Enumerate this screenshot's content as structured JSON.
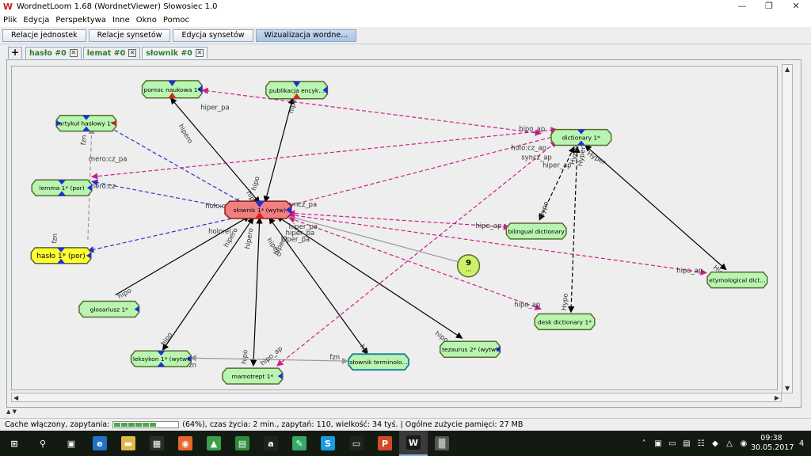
{
  "window": {
    "title": "WordnetLoom 1.68 (WordnetViewer) Słowosiec 1.0",
    "icon": "wordnetloom-app-icon",
    "minimize_label": "—",
    "maximize_label": "❐",
    "close_label": "✕"
  },
  "menu": [
    "Plik",
    "Edycja",
    "Perspektywa",
    "Inne",
    "Okno",
    "Pomoc"
  ],
  "toolbar": {
    "tabs": [
      "Relacje jednostek",
      "Relacje synsetów",
      "Edycja synsetów",
      "Wizualizacja wordne..."
    ],
    "active_index": 3
  },
  "doc_tabs": {
    "add_label": "+",
    "tabs": [
      {
        "label": "hasło #0",
        "close": "✕"
      },
      {
        "label": "lemat #0",
        "close": "✕"
      },
      {
        "label": "słownik #0",
        "close": "✕"
      }
    ],
    "selected_index": 2
  },
  "graph": {
    "colors": {
      "node_green": "#b9f5b0",
      "node_red": "#f08080",
      "node_yellow": "#ffff33",
      "node_cyan": "#b9f5b0",
      "blue_tri": "#1e2fd6",
      "red_tri": "#e01e1e",
      "edge_black": "#000000",
      "edge_pink": "#d11a8a",
      "edge_blue": "#2233cc",
      "edge_gray": "#999999"
    },
    "nodes": {
      "slownik": "słownik 1* (wytw)",
      "pomoc": "pomoc naukowa 1*",
      "publikacja": "publikacja encyk...",
      "artykul": "artykuł hasłowy 1*",
      "lemma": "lemma 1* (por)",
      "haslo": "hasło 1* (por)",
      "glosariusz": "glosariusz 1*",
      "leksykon": "leksykon 1* (wytw)",
      "mamotrept": "mamotrept 1*",
      "terminolog": "słownik terminolo...",
      "tezaurus": "tezaurus 2* (wytw)",
      "dictionary": "dictionary 1*",
      "bilingual": "bilingual dictionary",
      "desk": "desk dictionary 1*",
      "etymological": "etymological dict...",
      "cluster_count": "9",
      "cluster_dots": "..."
    },
    "labels": {
      "hiper_pa": "hiper_pa",
      "hipero": "hipero",
      "hipo": "hipo",
      "hipo_ap": "hipo_ap",
      "holo_cz": "holo:cz",
      "holo_cz_ap": "holo:cz_ap",
      "holo_el": "holo:el",
      "mero_cz": "mero:cz",
      "mero_cz_pa": "mero:cz_pa",
      "syncz_pa": "syncz_pa",
      "syncz_ap": "syncz_ap",
      "hiper_ap": "hiper_ap",
      "fzn": "fzn",
      "hyper": "Hyper",
      "hypo": "Hypo"
    }
  },
  "status": {
    "prefix": "Cache włączony, zapytania:",
    "progress_percent": 64,
    "suffix": "(64%), czas życia: 2 min., zapytań: 110, wielkość: 34 tyś. | Ogólne zużycie pamięci: 27 MB"
  },
  "taskbar": {
    "apps": [
      {
        "icon": "windows-start-icon",
        "glyph": "⊞"
      },
      {
        "icon": "search-icon",
        "glyph": "⚲"
      },
      {
        "icon": "task-view-icon",
        "glyph": "▣"
      },
      {
        "icon": "edge-icon",
        "glyph": "e"
      },
      {
        "icon": "file-explorer-icon",
        "glyph": "▬"
      },
      {
        "icon": "store-icon",
        "glyph": "▦"
      },
      {
        "icon": "firefox-icon",
        "glyph": "◉"
      },
      {
        "icon": "photos-icon",
        "glyph": "▲"
      },
      {
        "icon": "spreadsheet-icon",
        "glyph": "▤"
      },
      {
        "icon": "amazon-icon",
        "glyph": "a"
      },
      {
        "icon": "paint-icon",
        "glyph": "✎"
      },
      {
        "icon": "skype-icon",
        "glyph": "S"
      },
      {
        "icon": "terminal-icon",
        "glyph": "▭"
      },
      {
        "icon": "powerpoint-icon",
        "glyph": "P"
      },
      {
        "icon": "wordnetloom-icon",
        "glyph": "W"
      },
      {
        "icon": "calculator-icon",
        "glyph": "▒"
      }
    ],
    "active_index": 14,
    "colors": [
      "#131a12",
      "#131a12",
      "#131a12",
      "#1e72c8",
      "#e0b84a",
      "#2d2d2d",
      "#e8662a",
      "#3aa04a",
      "#2e8b3a",
      "#222",
      "#3a6",
      "#1a9be0",
      "#222",
      "#d04a2a",
      "#1a1a1a",
      "#555"
    ],
    "tray": [
      "˄",
      "▣",
      "▭",
      "▤",
      "☷",
      "◆",
      "△",
      "◉"
    ],
    "time": "09:38",
    "date": "30.05.2017",
    "notifications": "4"
  }
}
